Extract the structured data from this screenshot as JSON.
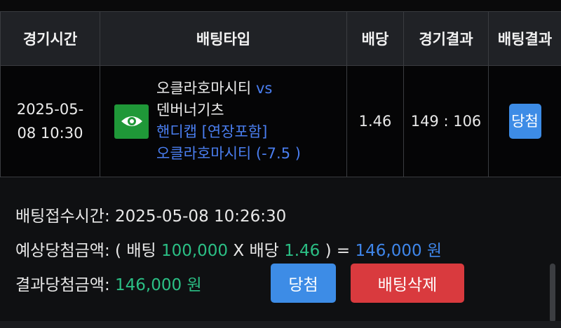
{
  "table": {
    "headers": [
      "경기시간",
      "배팅타입",
      "배당",
      "경기결과",
      "배팅결과"
    ],
    "row": {
      "time_line1": "2025-05-",
      "time_line2": "08 10:30",
      "icon": "eye-icon",
      "home_team": "오클라호마시티",
      "vs": "vs",
      "away_team": "덴버너기츠",
      "bet_type": "핸디캡 [연장포함]",
      "pick": "오클라호마시티 (-7.5 )",
      "odds": "1.46",
      "score": "149 : 106",
      "result": "당첨"
    }
  },
  "details": {
    "bet_time_label": "배팅접수시간:",
    "bet_time_value": "2025-05-08 10:26:30",
    "expected_label": "예상당첨금액:",
    "expected_open": "( 배팅",
    "stake": "100,000",
    "times_label": "X 배당",
    "odds": "1.46",
    "expected_close": ") =",
    "expected_amount": "146,000 원",
    "result_label": "결과당첨금액:",
    "result_amount": "146,000 원"
  },
  "buttons": {
    "win_label": "당첨",
    "delete_label": "배팅삭제"
  },
  "colors": {
    "accent_blue": "#3d8ce6",
    "green": "#2bbf85",
    "danger_red": "#d93a3e",
    "icon_green": "#1f9838"
  }
}
